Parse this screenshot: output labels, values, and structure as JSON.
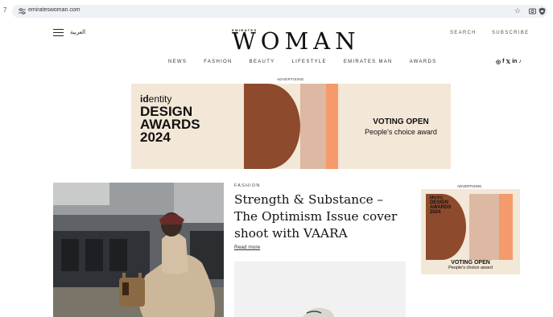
{
  "browser": {
    "url": "emirateswoman.com",
    "nav_glyph": "7",
    "star_glyph": "☆"
  },
  "header": {
    "lang_link": "العربية",
    "logo_small": "EMIRATES",
    "logo_big": "WOMAN",
    "search": "SEARCH",
    "subscribe": "SUBSCRIBE"
  },
  "nav": {
    "items": [
      "NEWS",
      "FASHION",
      "BEAUTY",
      "LIFESTYLE",
      "EMIRATES MAN",
      "AWARDS"
    ]
  },
  "social": {
    "icons": [
      "instagram-icon",
      "facebook-icon",
      "twitter-icon",
      "linkedin-icon",
      "tiktok-icon"
    ],
    "glyphs": [
      "◎",
      "f",
      "𝕏",
      "in",
      "♪"
    ]
  },
  "ad_top": {
    "label": "ADVERTISING",
    "logo_bold": "id",
    "logo_rest": "entity",
    "title_line1": "DESIGN",
    "title_line2": "AWARDS",
    "title_line3": "2024",
    "voting_title": "VOTING OPEN",
    "voting_sub": "People's choice award",
    "colors": {
      "bg": "#f3e7d7",
      "brown": "#8e4a2c",
      "pink": "#ddb8a2",
      "orange": "#f49a6b"
    }
  },
  "article": {
    "category": "FASHION",
    "headline": "Strength & Substance – The Optimism Issue cover shoot with VAARA",
    "read_more": "Read more"
  },
  "ad_side": {
    "label": "ADVERTISING",
    "logo_bold": "id",
    "logo_rest": "entity",
    "title_line1": "DESIGN",
    "title_line2": "AWARDS",
    "title_line3": "2024",
    "voting_title": "VOTING OPEN",
    "voting_sub": "People's choice award"
  }
}
